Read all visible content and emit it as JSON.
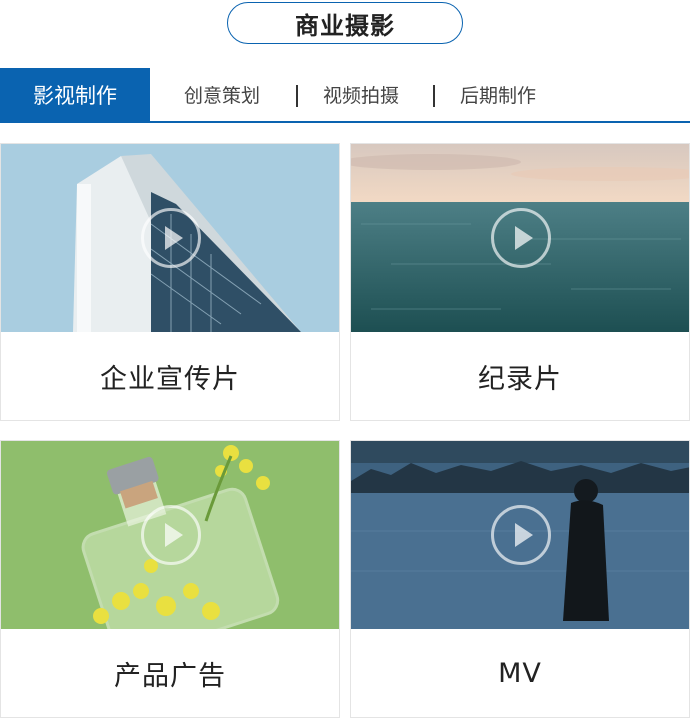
{
  "section_title": "商业摄影",
  "tabs": {
    "active": "影视制作",
    "items": [
      {
        "label": "创意策划"
      },
      {
        "label": "视频拍摄"
      },
      {
        "label": "后期制作"
      }
    ],
    "separator": "|"
  },
  "cards": [
    {
      "label": "企业宣传片",
      "icon": "play-icon"
    },
    {
      "label": "纪录片",
      "icon": "play-icon"
    },
    {
      "label": "产品广告",
      "icon": "play-icon"
    },
    {
      "label": "MV",
      "icon": "play-icon"
    }
  ],
  "colors": {
    "accent": "#0a63b0"
  }
}
